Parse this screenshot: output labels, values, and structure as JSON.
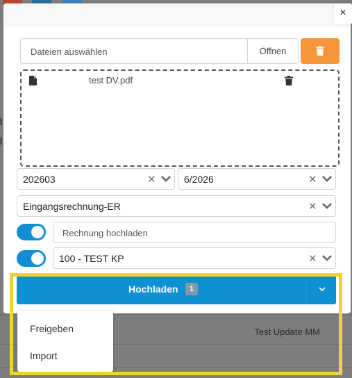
{
  "background": {
    "row_text": "Test Update MM",
    "chip_colors": [
      "#c0392b",
      "#2c6e99",
      "#3a7fb8"
    ]
  },
  "modal": {
    "close_symbol": "×",
    "file_input": {
      "placeholder": "Dateien auswählen",
      "open_label": "Öffnen",
      "delete_button_color": "#f7953b"
    },
    "dropzone": {
      "files": [
        {
          "name": "test DV.pdf",
          "icon": "file-icon"
        }
      ]
    },
    "period_select": {
      "value": "202603"
    },
    "month_select": {
      "value": "6/2026"
    },
    "type_select": {
      "value": "Eingangsrechnung-ER"
    },
    "invoice_upload": {
      "toggle_on": true,
      "placeholder": "Rechnung hochladen"
    },
    "cost_center": {
      "toggle_on": true,
      "value": "100 - TEST KP"
    },
    "upload_button": {
      "label": "Hochladen",
      "badge": "1",
      "color": "#0f90d4"
    },
    "upload_menu": {
      "items": [
        "Freigeben",
        "Import"
      ]
    }
  },
  "highlight_color": "#f0d232"
}
